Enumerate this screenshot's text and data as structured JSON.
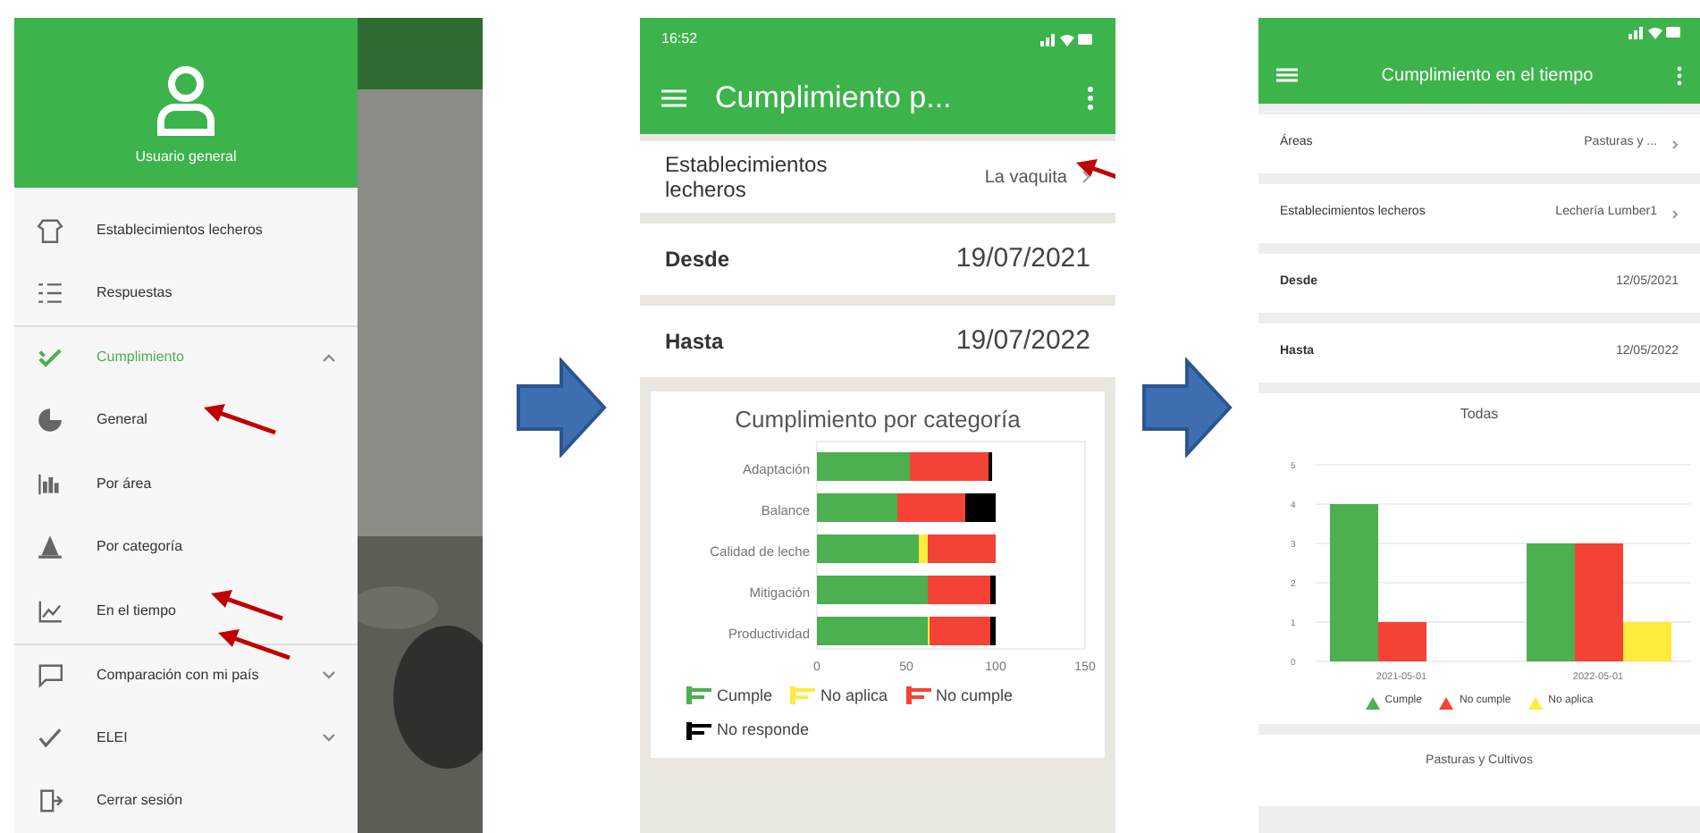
{
  "drawer_screen": {
    "user_name": "Usuario general",
    "menu": [
      {
        "label": "Establecimientos lecheros",
        "kind": "item",
        "selected": false
      },
      {
        "label": "Respuestas",
        "kind": "item",
        "selected": false
      },
      {
        "label": "Cumplimiento",
        "kind": "group",
        "selected": true,
        "expanded": true
      },
      {
        "label": "General",
        "kind": "item",
        "selected": false
      },
      {
        "label": "Por área",
        "kind": "item",
        "selected": false
      },
      {
        "label": "Por categoría",
        "kind": "item",
        "selected": false
      },
      {
        "label": "En el tiempo",
        "kind": "item",
        "selected": false
      },
      {
        "label": "Comparación con mi país",
        "kind": "group",
        "selected": false,
        "expanded": false
      },
      {
        "label": "ELEI",
        "kind": "group",
        "selected": false,
        "expanded": false
      },
      {
        "label": "Cerrar sesión",
        "kind": "item",
        "selected": false
      }
    ]
  },
  "category_screen": {
    "time": "16:52",
    "title": "Cumplimiento p...",
    "filters": [
      {
        "label": "Establecimientos lecheros",
        "value": "La vaquita",
        "kind": "select"
      },
      {
        "label": "Desde",
        "value": "19/07/2021",
        "kind": "date"
      },
      {
        "label": "Hasta",
        "value": "19/07/2022",
        "kind": "date"
      }
    ],
    "chart_data": {
      "type": "bar",
      "orientation": "horizontal",
      "stacked": true,
      "title": "Cumplimiento por categoría",
      "categories": [
        "Adaptación",
        "Balance",
        "Calidad de leche",
        "Mitigación",
        "Productividad"
      ],
      "xlim": [
        0,
        150
      ],
      "xticks": [
        0,
        50,
        100,
        150
      ],
      "legend": "bottom",
      "series": [
        {
          "name": "Cumple",
          "color": "#4caf50",
          "values": [
            52,
            45,
            57,
            62,
            62
          ]
        },
        {
          "name": "No aplica",
          "color": "#ffeb3b",
          "values": [
            0,
            0,
            5,
            0,
            1
          ]
        },
        {
          "name": "No cumple",
          "color": "#f44336",
          "values": [
            44,
            38,
            38,
            35,
            34
          ]
        },
        {
          "name": "No responde",
          "color": "#000000",
          "values": [
            2,
            17,
            0,
            3,
            3
          ]
        }
      ]
    }
  },
  "time_screen": {
    "title": "Cumplimiento en el tiempo",
    "filters": [
      {
        "label": "Áreas",
        "value": "Pasturas y ...",
        "kind": "select"
      },
      {
        "label": "Establecimientos lecheros",
        "value": "Lechería Lumber1",
        "kind": "select"
      },
      {
        "label": "Desde",
        "value": "12/05/2021",
        "kind": "date"
      },
      {
        "label": "Hasta",
        "value": "12/05/2022",
        "kind": "date"
      }
    ],
    "chart_data": {
      "type": "bar",
      "title": "Todas",
      "categories": [
        "2021-05-01",
        "2022-05-01"
      ],
      "ylim": [
        0,
        5
      ],
      "yticks": [
        0,
        1,
        2,
        3,
        4,
        5
      ],
      "grid": true,
      "legend": "bottom",
      "series": [
        {
          "name": "Cumple",
          "color": "#4caf50",
          "values": [
            4,
            3
          ]
        },
        {
          "name": "No cumple",
          "color": "#f44336",
          "values": [
            1,
            3
          ]
        },
        {
          "name": "No aplica",
          "color": "#ffeb3b",
          "values": [
            0,
            1
          ]
        }
      ]
    },
    "next_chart_title": "Pasturas y Cultivos"
  }
}
